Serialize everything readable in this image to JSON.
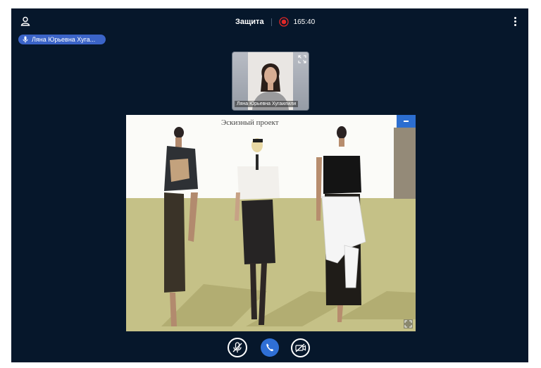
{
  "topbar": {
    "title": "Защита",
    "timer": "165:40"
  },
  "speaker_pill": {
    "name": "Ляна Юрьевна Хуга..."
  },
  "thumbnail": {
    "label": "Ляна Юрьевна Хугаилили"
  },
  "slide": {
    "title": "Эскизный проект"
  },
  "colors": {
    "app_bg": "#06172b",
    "accent": "#2f6fd5",
    "pill": "#3b64c8",
    "record": "#e02828"
  }
}
